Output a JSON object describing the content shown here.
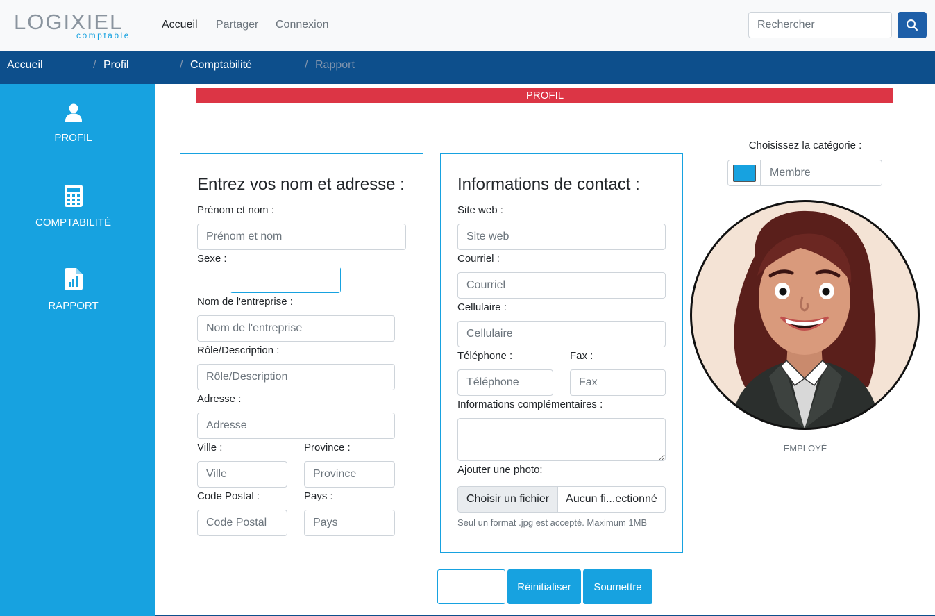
{
  "brand": {
    "name": "LOGIXIEL",
    "tagline": "comptable"
  },
  "nav": {
    "items": [
      "Accueil",
      "Partager",
      "Connexion"
    ],
    "active": "Accueil"
  },
  "search": {
    "placeholder": "Rechercher"
  },
  "breadcrumb": [
    {
      "label": "Accueil",
      "linked": true
    },
    {
      "label": "Profil",
      "linked": true
    },
    {
      "label": "Comptabilité",
      "linked": true
    },
    {
      "label": "Rapport",
      "linked": false
    }
  ],
  "breadcrumb_separator": "/",
  "sidebar": {
    "items": [
      {
        "label": "PROFIL",
        "icon": "user-icon"
      },
      {
        "label": "COMPTABILITÉ",
        "icon": "calculator-icon"
      },
      {
        "label": "RAPPORT",
        "icon": "report-icon"
      }
    ]
  },
  "page_title": "PROFIL",
  "address_card": {
    "title": "Entrez vos nom et adresse :",
    "name_label": "Prénom et nom :",
    "name_placeholder": "Prénom et nom",
    "sex_label": "Sexe :",
    "company_label": "Nom de l'entreprise :",
    "company_placeholder": "Nom de l'entreprise",
    "role_label": "Rôle/Description :",
    "role_placeholder": "Rôle/Description",
    "address_label": "Adresse :",
    "address_placeholder": "Adresse",
    "city_label": "Ville :",
    "city_placeholder": "Ville",
    "province_label": "Province :",
    "province_placeholder": "Province",
    "postal_label": "Code Postal :",
    "postal_placeholder": "Code Postal",
    "country_label": "Pays :",
    "country_placeholder": "Pays"
  },
  "contact_card": {
    "title": "Informations de contact :",
    "website_label": "Site web :",
    "website_placeholder": "Site web",
    "email_label": "Courriel :",
    "email_placeholder": "Courriel",
    "mobile_label": "Cellulaire :",
    "mobile_placeholder": "Cellulaire",
    "phone_label": "Téléphone :",
    "phone_placeholder": "Téléphone",
    "fax_label": "Fax :",
    "fax_placeholder": "Fax",
    "extra_label": "Informations complémentaires :",
    "photo_label": "Ajouter une photo:",
    "file_button": "Choisir un fichier",
    "file_name": "Aucun fi...ectionné",
    "file_help": "Seul un format .jpg est accepté. Maximum 1MB"
  },
  "category": {
    "label": "Choisissez la catégorie :",
    "placeholder": "Membre",
    "color": "#17a2e0"
  },
  "profile": {
    "role_caption": "EMPLOYÉ"
  },
  "actions": {
    "reset": "Réinitialiser",
    "submit": "Soumettre"
  },
  "colors": {
    "primary": "#17a2e0",
    "navy": "#0d4f8c",
    "danger": "#dc3545",
    "search_button": "#1e5fa8"
  }
}
